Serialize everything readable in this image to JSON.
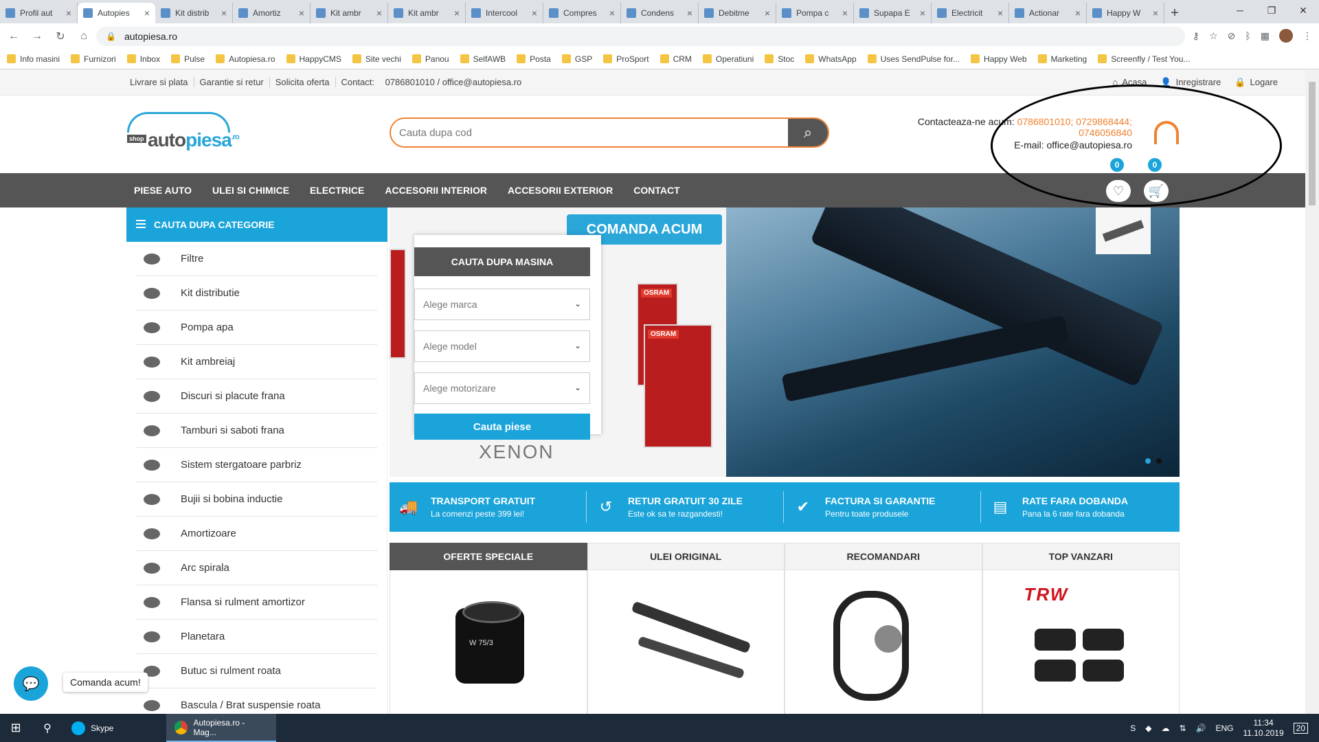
{
  "browser": {
    "tabs": [
      {
        "label": "Profil aut",
        "active": false
      },
      {
        "label": "Autopies",
        "active": true
      },
      {
        "label": "Kit distrib",
        "active": false
      },
      {
        "label": "Amortiz",
        "active": false
      },
      {
        "label": "Kit ambr",
        "active": false
      },
      {
        "label": "Kit ambr",
        "active": false
      },
      {
        "label": "Intercool",
        "active": false
      },
      {
        "label": "Compres",
        "active": false
      },
      {
        "label": "Condens",
        "active": false
      },
      {
        "label": "Debitme",
        "active": false
      },
      {
        "label": "Pompa c",
        "active": false
      },
      {
        "label": "Supapa E",
        "active": false
      },
      {
        "label": "Electricit",
        "active": false
      },
      {
        "label": "Actionar",
        "active": false
      },
      {
        "label": "Happy W",
        "active": false
      }
    ],
    "url": "autopiesa.ro",
    "bookmarks": [
      "Info masini",
      "Furnizori",
      "Inbox",
      "Pulse",
      "Autopiesa.ro",
      "HappyCMS",
      "Site vechi",
      "Panou",
      "SelfAWB",
      "Posta",
      "GSP",
      "ProSport",
      "CRM",
      "Operatiuni",
      "Stoc",
      "WhatsApp",
      "Uses SendPulse for...",
      "Happy Web",
      "Marketing",
      "Screenfly / Test You..."
    ]
  },
  "topbar": {
    "links": [
      "Livrare si plata",
      "Garantie si retur",
      "Solicita oferta"
    ],
    "contact_label": "Contact:",
    "contact_value": "0786801010 / office@autopiesa.ro",
    "right": [
      "Acasa",
      "Inregistrare",
      "Logare"
    ]
  },
  "logo": {
    "shop": "shop",
    "word_a": "auto",
    "word_b": "piesa",
    "suffix": ".ro"
  },
  "search": {
    "placeholder": "Cauta dupa cod"
  },
  "contact": {
    "prefix": "Contacteaza-ne acum:",
    "phones_line1": "0786801010; 0729868444;",
    "phones_line2": "0746056840",
    "email": "E-mail: office@autopiesa.ro"
  },
  "menu": {
    "items": [
      "PIESE AUTO",
      "ULEI SI CHIMICE",
      "ELECTRICE",
      "ACCESORII INTERIOR",
      "ACCESORII EXTERIOR",
      "CONTACT"
    ],
    "wishlist_count": "0",
    "cart_count": "0"
  },
  "categories": {
    "title": "CAUTA DUPA CATEGORIE",
    "items": [
      "Filtre",
      "Kit distributie",
      "Pompa apa",
      "Kit ambreiaj",
      "Discuri si placute frana",
      "Tamburi si saboti frana",
      "Sistem stergatoare parbriz",
      "Bujii si bobina inductie",
      "Amortizoare",
      "Arc spirala",
      "Flansa si rulment amortizor",
      "Planetara",
      "Butuc si rulment roata",
      "Bascula / Brat suspensie roata"
    ]
  },
  "banner": {
    "cta": "COMANDA ACUM",
    "xenon": "XENON",
    "brand": "OSRAM"
  },
  "car_search": {
    "title": "CAUTA DUPA MASINA",
    "brand": "Alege marca",
    "model": "Alege model",
    "engine": "Alege motorizare",
    "button": "Cauta piese"
  },
  "features": [
    {
      "title": "TRANSPORT GRATUIT",
      "sub": "La comenzi peste 399 lei!"
    },
    {
      "title": "RETUR GRATUIT 30 ZILE",
      "sub": "Este ok sa te razgandesti!"
    },
    {
      "title": "FACTURA SI GARANTIE",
      "sub": "Pentru toate produsele"
    },
    {
      "title": "RATE FARA DOBANDA",
      "sub": "Pana la 6 rate fara dobanda"
    }
  ],
  "product_tabs": [
    "OFERTE SPECIALE",
    "ULEI ORIGINAL",
    "RECOMANDARI",
    "TOP VANZARI"
  ],
  "products": {
    "trw": "TRW",
    "filter_label": "W 75/3"
  },
  "chat": {
    "label": "Comanda acum!"
  },
  "taskbar": {
    "apps": [
      {
        "label": "Skype"
      },
      {
        "label": "Autopiesa.ro - Mag..."
      }
    ],
    "lang": "ENG",
    "time": "11:34",
    "date": "11.10.2019",
    "notif": "20"
  },
  "colors": {
    "accent_blue": "#1aa4da",
    "accent_orange": "#f0812f",
    "menu_gray": "#555555"
  }
}
